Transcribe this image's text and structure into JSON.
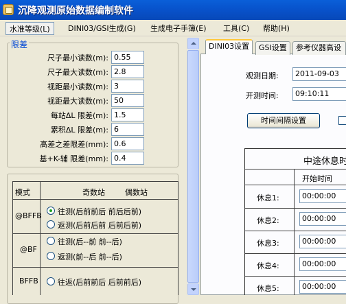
{
  "window": {
    "title": "沉降观测原始数据编制软件"
  },
  "menu": [
    {
      "label": "水准等级(L)"
    },
    {
      "label": "DINI03/GSI生成(G)"
    },
    {
      "label": "生成电子手簿(E)"
    },
    {
      "label": "工具(C)"
    },
    {
      "label": "帮助(H)"
    }
  ],
  "limits": {
    "legend": "限差",
    "fields": [
      {
        "label": "尺子最小读数(m):",
        "value": "0.55"
      },
      {
        "label": "尺子最大读数(m):",
        "value": "2.8"
      },
      {
        "label": "视距最小读数(m):",
        "value": "3"
      },
      {
        "label": "视距最大读数(m):",
        "value": "50"
      },
      {
        "label": "每站ΔL 限差(m):",
        "value": "1.5"
      },
      {
        "label": "累积ΔL 限差(m):",
        "value": "6"
      },
      {
        "label": "高差之差限差(mm):",
        "value": "0.6"
      },
      {
        "label": "基+K-辅 限差(mm):",
        "value": "0.4"
      }
    ]
  },
  "mode_table": {
    "headers": {
      "mode": "模式",
      "odd": "奇数站",
      "even": "偶数站"
    },
    "rows": [
      {
        "mode": "@BFFB",
        "options": [
          {
            "label": "往测(后前前后 前后后前)",
            "checked": true
          },
          {
            "label": "返测(后前后前 后前后前)",
            "checked": false
          }
        ]
      },
      {
        "mode": "@BF",
        "options": [
          {
            "label": "往测(后--前 前--后)",
            "checked": false
          },
          {
            "label": "返测(前--后 前--后)",
            "checked": false
          }
        ]
      },
      {
        "mode": "BFFB",
        "options": [
          {
            "label": "往返(后前前后 后前前后)",
            "checked": false
          }
        ]
      }
    ]
  },
  "tabs": [
    {
      "label": "DINI03设置",
      "active": true
    },
    {
      "label": "GSI设置",
      "active": false
    },
    {
      "label": "参考仪器高设",
      "active": false
    }
  ],
  "dini03": {
    "date_label": "观测日期:",
    "date_value": "2011-09-03",
    "time_label": "开测时间:",
    "time_value": "09:10:11",
    "interval_button": "时间间隔设置",
    "rest_table": {
      "title": "中途休息时",
      "start_header": "开始时间",
      "rows": [
        {
          "label": "休息1:",
          "value": "00:00:00"
        },
        {
          "label": "休息2:",
          "value": "00:00:00"
        },
        {
          "label": "休息3:",
          "value": "00:00:00"
        },
        {
          "label": "休息4:",
          "value": "00:00:00"
        },
        {
          "label": "休息5:",
          "value": "00:00:00"
        }
      ]
    }
  },
  "colors": {
    "titlebar": "#0853cc",
    "legend_text": "#0046d5",
    "window_bg": "#ece9d8"
  }
}
